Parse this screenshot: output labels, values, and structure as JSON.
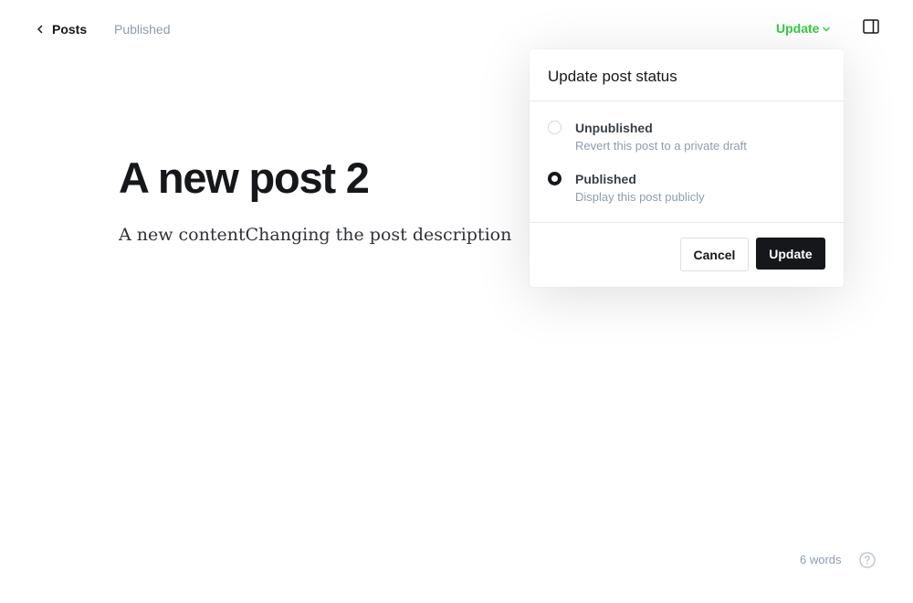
{
  "header": {
    "back_label": "Posts",
    "status_text": "Published",
    "update_label": "Update",
    "accent_color": "#30cf43"
  },
  "post": {
    "title": "A new post 2",
    "body": "A new contentChanging the post description"
  },
  "popover": {
    "title": "Update post status",
    "options": [
      {
        "label": "Unpublished",
        "description": "Revert this post to a private draft",
        "selected": false
      },
      {
        "label": "Published",
        "description": "Display this post publicly",
        "selected": true
      }
    ],
    "cancel_label": "Cancel",
    "update_label": "Update"
  },
  "footer": {
    "word_count": "6 words",
    "help_icon": "question-circle-icon"
  },
  "icons": {
    "back": "chevron-left-icon",
    "dropdown": "chevron-down-icon",
    "sidebar": "sidebar-toggle-icon"
  }
}
